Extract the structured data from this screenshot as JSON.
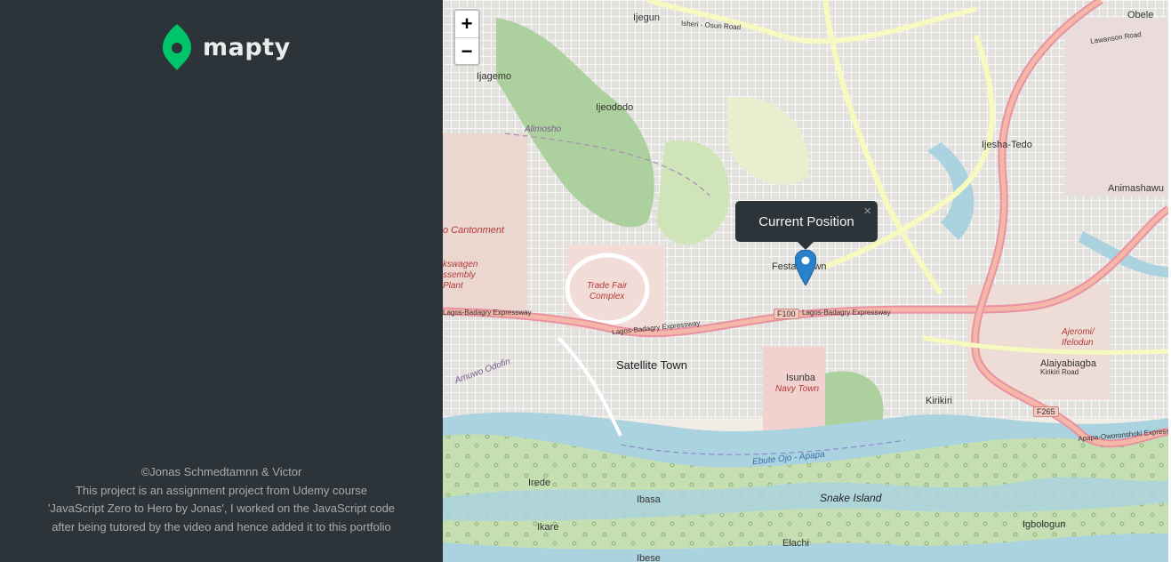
{
  "logo": {
    "text": "mapty",
    "icon": "map-pin-icon",
    "accent": "#00c46a"
  },
  "footer": {
    "lines": [
      "©Jonas Schmedtamnn & Victor",
      "This project is an assignment project from Udemy course",
      "'JavaScript Zero to Hero by Jonas', I worked on the JavaScript code",
      "after being tutored by the video and hence added it to this portfolio"
    ]
  },
  "map": {
    "zoom_in": "+",
    "zoom_out": "−",
    "popup": {
      "text": "Current Position",
      "close": "×"
    },
    "places": {
      "ijegun": "Ijegun",
      "obele": "Obele",
      "ijagemo": "Ijagemo",
      "ijeododo": "Ijeododo",
      "alimosho": "Alimosho",
      "ijesha_tedo": "Ijesha-Tedo",
      "animashawun": "Animashawu",
      "cantonment": "o Cantonment",
      "volkswagen": "kswagen\nssembly\nPlant",
      "trade_fair": "Trade Fair\nComplex",
      "festac": "Festac Town",
      "satellite": "Satellite Town",
      "isunba": "Isunba",
      "navy_town": "Navy Town",
      "alaiyabiagba": "Alaiyabiagba",
      "kirikiri": "Kirikiri",
      "ajeromi": "Ajeromi/\nIfelodun",
      "amuwo": "Amuwo Odofin",
      "irede": "Irede",
      "ibasa": "Ibasa",
      "snake_island": "Snake Island",
      "ikare": "Ikare",
      "elachi": "Elachi",
      "igbologun": "Igbologun",
      "ibese": "Ibese",
      "ebute": "Ebute Ojo - Apapa"
    },
    "roads": {
      "isheri": "Isheri - Osun Road",
      "lawanson": "Lawanson Road",
      "lagos_badagry_1": "Lagos-Badagry Expressway",
      "lagos_badagry_2": "Lagos-Badagry Expressway",
      "lagos_badagry_3": "Lagos-Badagry Expressway",
      "kirikiri_road": "Kirikiri Road",
      "apapa_oworonshoki": "Apapa-Oworonshoki Expressway"
    },
    "shields": {
      "f100": "F100",
      "f265": "F265"
    },
    "colors": {
      "water": "#aad3df",
      "green": "#add19e",
      "road_major": "#e892a2",
      "road_yellow": "#f7fabf"
    }
  }
}
